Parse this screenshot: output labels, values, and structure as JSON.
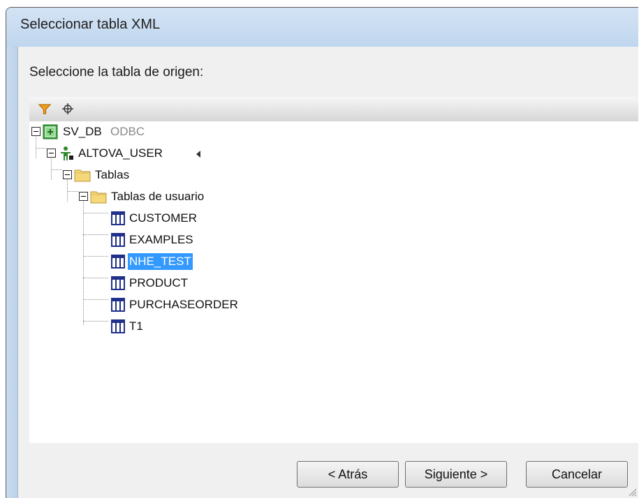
{
  "window": {
    "title": "Seleccionar tabla XML"
  },
  "prompt": "Seleccione la tabla de origen:",
  "toolbar": {
    "icons": [
      "filter-icon",
      "crosshair-icon"
    ]
  },
  "tree": {
    "root": {
      "label": "SV_DB",
      "kind": "ODBC",
      "icon": "database-icon"
    },
    "schema": {
      "label": "ALTOVA_USER",
      "icon": "user-icon"
    },
    "folder1": {
      "label": "Tablas",
      "icon": "folder-icon"
    },
    "folder2": {
      "label": "Tablas de usuario",
      "icon": "folder-icon"
    },
    "tables": [
      {
        "label": "CUSTOMER",
        "selected": false
      },
      {
        "label": "EXAMPLES",
        "selected": false
      },
      {
        "label": "NHE_TEST",
        "selected": true
      },
      {
        "label": "PRODUCT",
        "selected": false
      },
      {
        "label": "PURCHASEORDER",
        "selected": false
      },
      {
        "label": "T1",
        "selected": false
      }
    ]
  },
  "buttons": {
    "back": "< Atrás",
    "next": "Siguiente >",
    "cancel": "Cancelar"
  },
  "colors": {
    "selection": "#3399ff",
    "titlebar": "#c8dcf1",
    "folder": "#f5d879",
    "table_icon": "#1f2f8a",
    "database": "#3da63d"
  }
}
